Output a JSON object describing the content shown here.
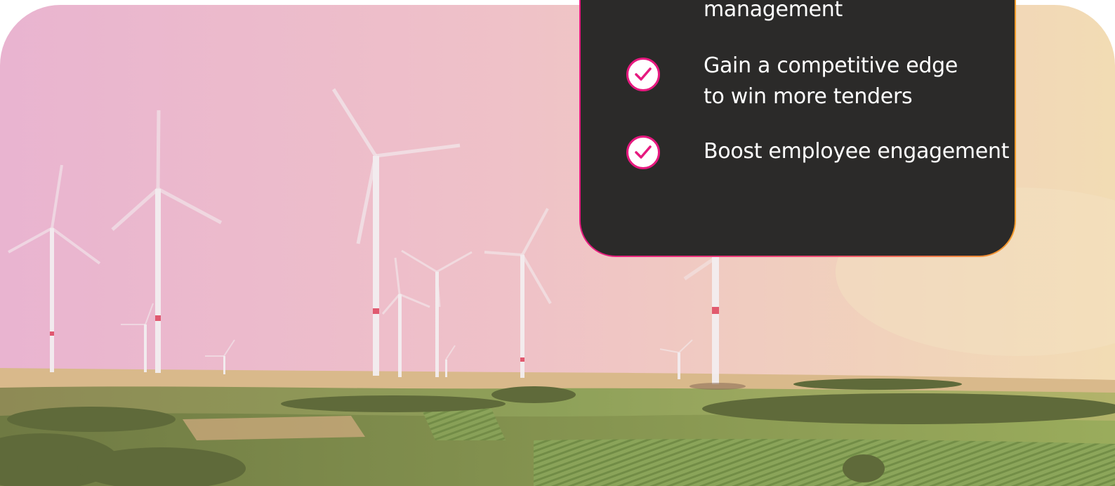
{
  "benefits": {
    "items": [
      {
        "text": "management",
        "icon": "check-circle-icon"
      },
      {
        "text": "Gain a competitive edge to win more tenders",
        "icon": "check-circle-icon"
      },
      {
        "text": "Boost employee engagement",
        "icon": "check-circle-icon"
      }
    ]
  },
  "colors": {
    "card_bg": "#2b2a29",
    "accent_pink": "#e6197f",
    "accent_orange": "#f39a2a",
    "text": "#ffffff"
  }
}
